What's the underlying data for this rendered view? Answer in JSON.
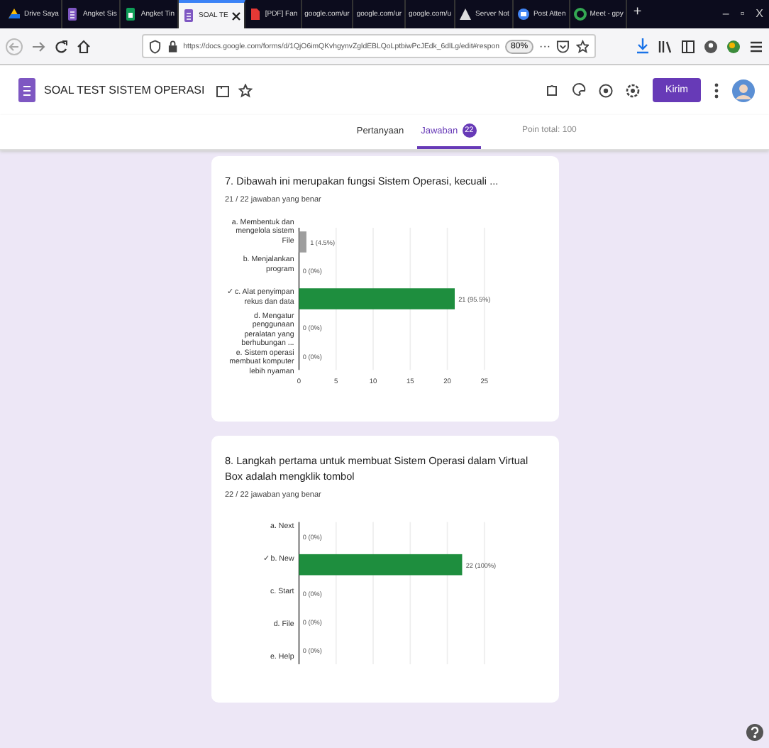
{
  "browser": {
    "tabs": [
      {
        "label": "Drive Saya",
        "selected": false
      },
      {
        "label": "Angket Sis",
        "selected": false
      },
      {
        "label": "Angket Tin",
        "selected": false
      },
      {
        "label": "SOAL TE",
        "selected": true
      },
      {
        "label": "[PDF] Fan",
        "selected": false
      },
      {
        "label": "google.com/ur",
        "selected": false
      },
      {
        "label": "google.com/ur",
        "selected": false
      },
      {
        "label": "google.com/u",
        "selected": false
      },
      {
        "label": "Server Not",
        "selected": false
      },
      {
        "label": "Post Atten",
        "selected": false
      },
      {
        "label": "Meet - gpy",
        "selected": false
      }
    ],
    "new_tab": "+",
    "window_controls": [
      "–",
      "▫",
      "X"
    ],
    "more": "···",
    "url": "https://docs.google.com/forms/d/1QjO6imQKvhgynvZgldEBLQoLptbiwPcJEdk_6dlLg/edit#respon",
    "zoom": "80%"
  },
  "form": {
    "title": "SOAL TEST SISTEM OPERASI",
    "send_button": "Kirim",
    "tabs": [
      {
        "label": "Pertanyaan",
        "selected": false
      },
      {
        "label": "Jawaban",
        "badge": "22",
        "selected": true
      }
    ],
    "total_points": "Poin total: 100"
  },
  "questions": [
    {
      "title": "7. Dibawah ini merupakan fungsi Sistem Operasi, kecuali ...",
      "summary": "21 / 22 jawaban yang benar",
      "chart_data": {
        "type": "bar",
        "orientation": "horizontal",
        "categories": [
          "a. Membentuk dan mengelola sistem File",
          "b. Menjalankan program",
          "✓ c. Alat penyimpan rekus dan data",
          "d. Mengatur penggunaan peralatan yang berhubungan ...",
          "e. Sistem operasi membuat komputer lebih nyaman"
        ],
        "series": [
          {
            "color": "#1e8e3e",
            "values": [
              0,
              0,
              21,
              0,
              0
            ]
          },
          {
            "color": "#9e9e9e",
            "values": [
              1,
              0,
              0,
              0,
              0
            ]
          }
        ],
        "xlim": [
          0,
          25
        ],
        "xticks": [
          0,
          5,
          10,
          15,
          20,
          25
        ],
        "grid": true,
        "value_labels": [
          "1 (4.5%)",
          "0 (0%)",
          "21 (95.5%)",
          "0 (0%)",
          "0 (0%)"
        ]
      }
    },
    {
      "title": "8. Langkah pertama untuk membuat Sistem Operasi dalam Virtual Box adalah mengklik tombol",
      "summary": "22 / 22 jawaban yang benar",
      "chart_data": {
        "type": "bar",
        "orientation": "horizontal",
        "categories": [
          "a. Next",
          "✓ b. New",
          "c. Start",
          "d. File",
          "e. Help"
        ],
        "series": [
          {
            "color": "#1e8e3e",
            "values": [
              0,
              22,
              0,
              0,
              0
            ]
          }
        ],
        "xlim": [
          0,
          25
        ],
        "grid": true,
        "value_labels": [
          "0 (0%)",
          "22 (100%)",
          "0 (0%)",
          "0 (0%)",
          "0 (0%)"
        ]
      }
    }
  ]
}
